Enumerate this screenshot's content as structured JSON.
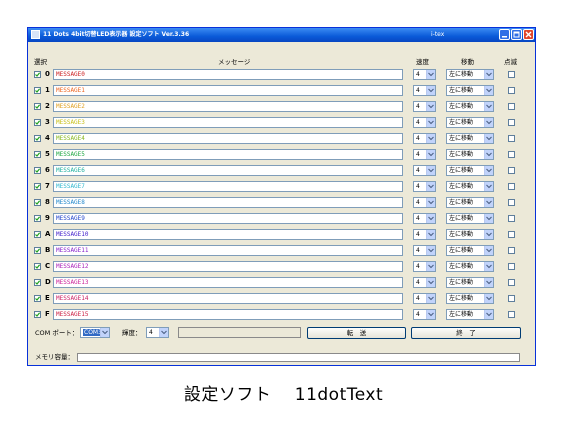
{
  "window": {
    "title": "11 Dots 4bit切替LED表示器  設定ソフト  Ver.3.36",
    "subtitle": "i-tex"
  },
  "header": {
    "select_label": "選択",
    "message_label": "メッセージ",
    "speed_label": "速度",
    "move_label": "移動",
    "blink_label": "点滅"
  },
  "rows": [
    {
      "id": "0",
      "message": "MESSAGE0",
      "color": "#cc2222",
      "checked": true,
      "speed": "4",
      "move": "左に移動",
      "blink": false
    },
    {
      "id": "1",
      "message": "MESSAGE1",
      "color": "#ee6622",
      "checked": true,
      "speed": "4",
      "move": "左に移動",
      "blink": false
    },
    {
      "id": "2",
      "message": "MESSAGE2",
      "color": "#e0a020",
      "checked": true,
      "speed": "4",
      "move": "左に移動",
      "blink": false
    },
    {
      "id": "3",
      "message": "MESSAGE3",
      "color": "#c8c018",
      "checked": true,
      "speed": "4",
      "move": "左に移動",
      "blink": false
    },
    {
      "id": "4",
      "message": "MESSAGE4",
      "color": "#88b820",
      "checked": true,
      "speed": "4",
      "move": "左に移動",
      "blink": false
    },
    {
      "id": "5",
      "message": "MESSAGE5",
      "color": "#22a844",
      "checked": true,
      "speed": "4",
      "move": "左に移動",
      "blink": false
    },
    {
      "id": "6",
      "message": "MESSAGE6",
      "color": "#20b0a0",
      "checked": true,
      "speed": "4",
      "move": "左に移動",
      "blink": false
    },
    {
      "id": "7",
      "message": "MESSAGE7",
      "color": "#30b8d0",
      "checked": true,
      "speed": "4",
      "move": "左に移動",
      "blink": false
    },
    {
      "id": "8",
      "message": "MESSAGE8",
      "color": "#2288cc",
      "checked": true,
      "speed": "4",
      "move": "左に移動",
      "blink": false
    },
    {
      "id": "9",
      "message": "MESSAGE9",
      "color": "#2244cc",
      "checked": true,
      "speed": "4",
      "move": "左に移動",
      "blink": false
    },
    {
      "id": "A",
      "message": "MESSAGE10",
      "color": "#4422cc",
      "checked": true,
      "speed": "4",
      "move": "左に移動",
      "blink": false
    },
    {
      "id": "B",
      "message": "MESSAGE11",
      "color": "#8822cc",
      "checked": true,
      "speed": "4",
      "move": "左に移動",
      "blink": false
    },
    {
      "id": "C",
      "message": "MESSAGE12",
      "color": "#aa22bb",
      "checked": true,
      "speed": "4",
      "move": "左に移動",
      "blink": false
    },
    {
      "id": "D",
      "message": "MESSAGE13",
      "color": "#cc2299",
      "checked": true,
      "speed": "4",
      "move": "左に移動",
      "blink": false
    },
    {
      "id": "E",
      "message": "MESSAGE14",
      "color": "#cc2266",
      "checked": true,
      "speed": "4",
      "move": "左に移動",
      "blink": false
    },
    {
      "id": "F",
      "message": "MESSAGE15",
      "color": "#cc2244",
      "checked": true,
      "speed": "4",
      "move": "左に移動",
      "blink": false
    }
  ],
  "bottom": {
    "com_label": "COM ポート：",
    "com_value": "COM3",
    "brightness_label": "輝度：",
    "brightness_value": "4",
    "status_text": "",
    "send_label": "転　送",
    "exit_label": "終　了",
    "memory_label": "メモリ容量：",
    "memory_fill": 0.0
  },
  "caption": "設定ソフト　 11dotText",
  "icons": {
    "app": "app-icon",
    "minimize": "minimize-icon",
    "maximize": "maximize-icon",
    "close": "close-icon",
    "dropdown": "chevron-down-icon",
    "check": "check-icon"
  }
}
